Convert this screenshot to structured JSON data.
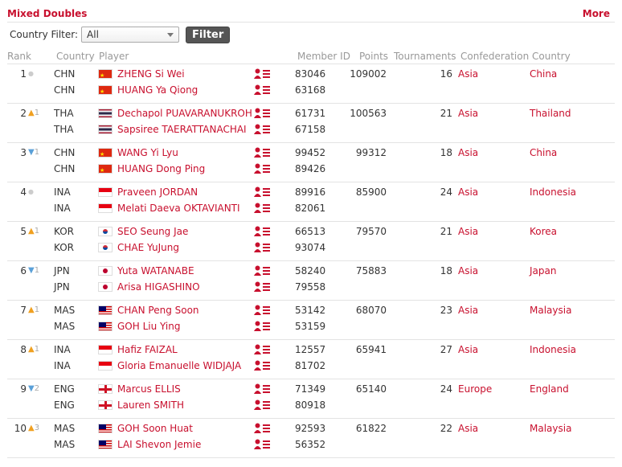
{
  "header": {
    "title": "Mixed Doubles",
    "more_label": "More"
  },
  "filter": {
    "label": "Country Filter:",
    "selected": "All",
    "button_label": "Filter"
  },
  "columns": {
    "rank": "Rank",
    "country_code": "Country",
    "player": "Player",
    "member_id": "Member ID",
    "points": "Points",
    "tournaments": "Tournaments",
    "confederation": "Confederation",
    "country": "Country"
  },
  "colors": {
    "accent": "#c8102e",
    "rank_up": "#f0a020",
    "rank_down": "#5aa0d8"
  },
  "rows": [
    {
      "rank": "1",
      "trend": "same",
      "change": "",
      "codes": [
        "CHN",
        "CHN"
      ],
      "flag": "chn",
      "players": [
        "ZHENG Si Wei",
        "HUANG Ya Qiong"
      ],
      "member_ids": [
        "83046",
        "63168"
      ],
      "points": "109002",
      "tournaments": "16",
      "confederation": "Asia",
      "country": "China"
    },
    {
      "rank": "2",
      "trend": "up",
      "change": "1",
      "codes": [
        "THA",
        "THA"
      ],
      "flag": "tha",
      "players": [
        "Dechapol PUAVARANUKROH",
        "Sapsiree TAERATTANACHAI"
      ],
      "member_ids": [
        "61731",
        "67158"
      ],
      "points": "100563",
      "tournaments": "21",
      "confederation": "Asia",
      "country": "Thailand"
    },
    {
      "rank": "3",
      "trend": "down",
      "change": "1",
      "codes": [
        "CHN",
        "CHN"
      ],
      "flag": "chn",
      "players": [
        "WANG Yi Lyu",
        "HUANG Dong Ping"
      ],
      "member_ids": [
        "99452",
        "89426"
      ],
      "points": "99312",
      "tournaments": "18",
      "confederation": "Asia",
      "country": "China"
    },
    {
      "rank": "4",
      "trend": "same",
      "change": "",
      "codes": [
        "INA",
        "INA"
      ],
      "flag": "ina",
      "players": [
        "Praveen JORDAN",
        "Melati Daeva OKTAVIANTI"
      ],
      "member_ids": [
        "89916",
        "82061"
      ],
      "points": "85900",
      "tournaments": "24",
      "confederation": "Asia",
      "country": "Indonesia"
    },
    {
      "rank": "5",
      "trend": "up",
      "change": "1",
      "codes": [
        "KOR",
        "KOR"
      ],
      "flag": "kor",
      "players": [
        "SEO Seung Jae",
        "CHAE YuJung"
      ],
      "member_ids": [
        "66513",
        "93074"
      ],
      "points": "79570",
      "tournaments": "21",
      "confederation": "Asia",
      "country": "Korea"
    },
    {
      "rank": "6",
      "trend": "down",
      "change": "1",
      "codes": [
        "JPN",
        "JPN"
      ],
      "flag": "jpn",
      "players": [
        "Yuta WATANABE",
        "Arisa HIGASHINO"
      ],
      "member_ids": [
        "58240",
        "79558"
      ],
      "points": "75883",
      "tournaments": "18",
      "confederation": "Asia",
      "country": "Japan"
    },
    {
      "rank": "7",
      "trend": "up",
      "change": "1",
      "codes": [
        "MAS",
        "MAS"
      ],
      "flag": "mas",
      "players": [
        "CHAN Peng Soon",
        "GOH Liu Ying"
      ],
      "member_ids": [
        "53142",
        "53159"
      ],
      "points": "68070",
      "tournaments": "23",
      "confederation": "Asia",
      "country": "Malaysia"
    },
    {
      "rank": "8",
      "trend": "up",
      "change": "1",
      "codes": [
        "INA",
        "INA"
      ],
      "flag": "ina",
      "players": [
        "Hafiz FAIZAL",
        "Gloria Emanuelle WIDJAJA"
      ],
      "member_ids": [
        "12557",
        "81702"
      ],
      "points": "65941",
      "tournaments": "27",
      "confederation": "Asia",
      "country": "Indonesia"
    },
    {
      "rank": "9",
      "trend": "down",
      "change": "2",
      "codes": [
        "ENG",
        "ENG"
      ],
      "flag": "eng",
      "players": [
        "Marcus ELLIS",
        "Lauren SMITH"
      ],
      "member_ids": [
        "71349",
        "80918"
      ],
      "points": "65140",
      "tournaments": "24",
      "confederation": "Europe",
      "country": "England"
    },
    {
      "rank": "10",
      "trend": "up",
      "change": "3",
      "codes": [
        "MAS",
        "MAS"
      ],
      "flag": "mas",
      "players": [
        "GOH Soon Huat",
        "LAI Shevon Jemie"
      ],
      "member_ids": [
        "92593",
        "56352"
      ],
      "points": "61822",
      "tournaments": "22",
      "confederation": "Asia",
      "country": "Malaysia"
    }
  ]
}
